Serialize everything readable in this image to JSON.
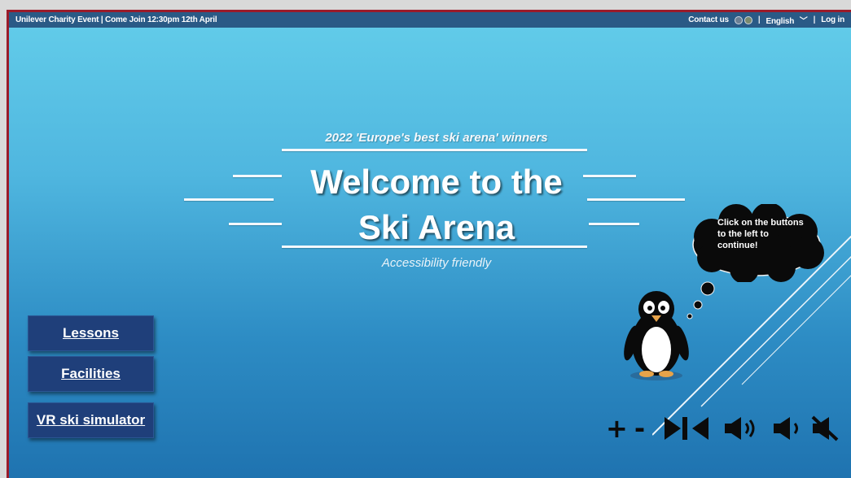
{
  "topbar": {
    "event_text": "Unilever Charity Event | Come Join 12:30pm 12th April",
    "contact_label": "Contact us",
    "separator": "|",
    "language_label": "English",
    "language_caret": "﹀",
    "login_label": "Log in"
  },
  "hero": {
    "award_text": "2022 'Europe's best ski arena' winners",
    "title_line1": "Welcome to the",
    "title_line2": "Ski Arena",
    "subtitle": "Accessibility friendly"
  },
  "nav": {
    "buttons": [
      "Lessons",
      "Facilities",
      "VR ski simulator"
    ]
  },
  "mascot": {
    "bubble_text": "Click on the buttons to the left to continue!"
  },
  "controls": {
    "zoom_in": "+",
    "zoom_out": "-",
    "icons": [
      "plus-icon",
      "minus-icon",
      "skip-icon",
      "volume-up-icon",
      "volume-down-icon",
      "mute-icon"
    ]
  },
  "colors": {
    "topbar": "#2a5a86",
    "frame_border": "#9a1b2a",
    "button_bg": "#1f3f7a",
    "sky_top": "#63cdea",
    "sky_bottom": "#1f73b0"
  }
}
